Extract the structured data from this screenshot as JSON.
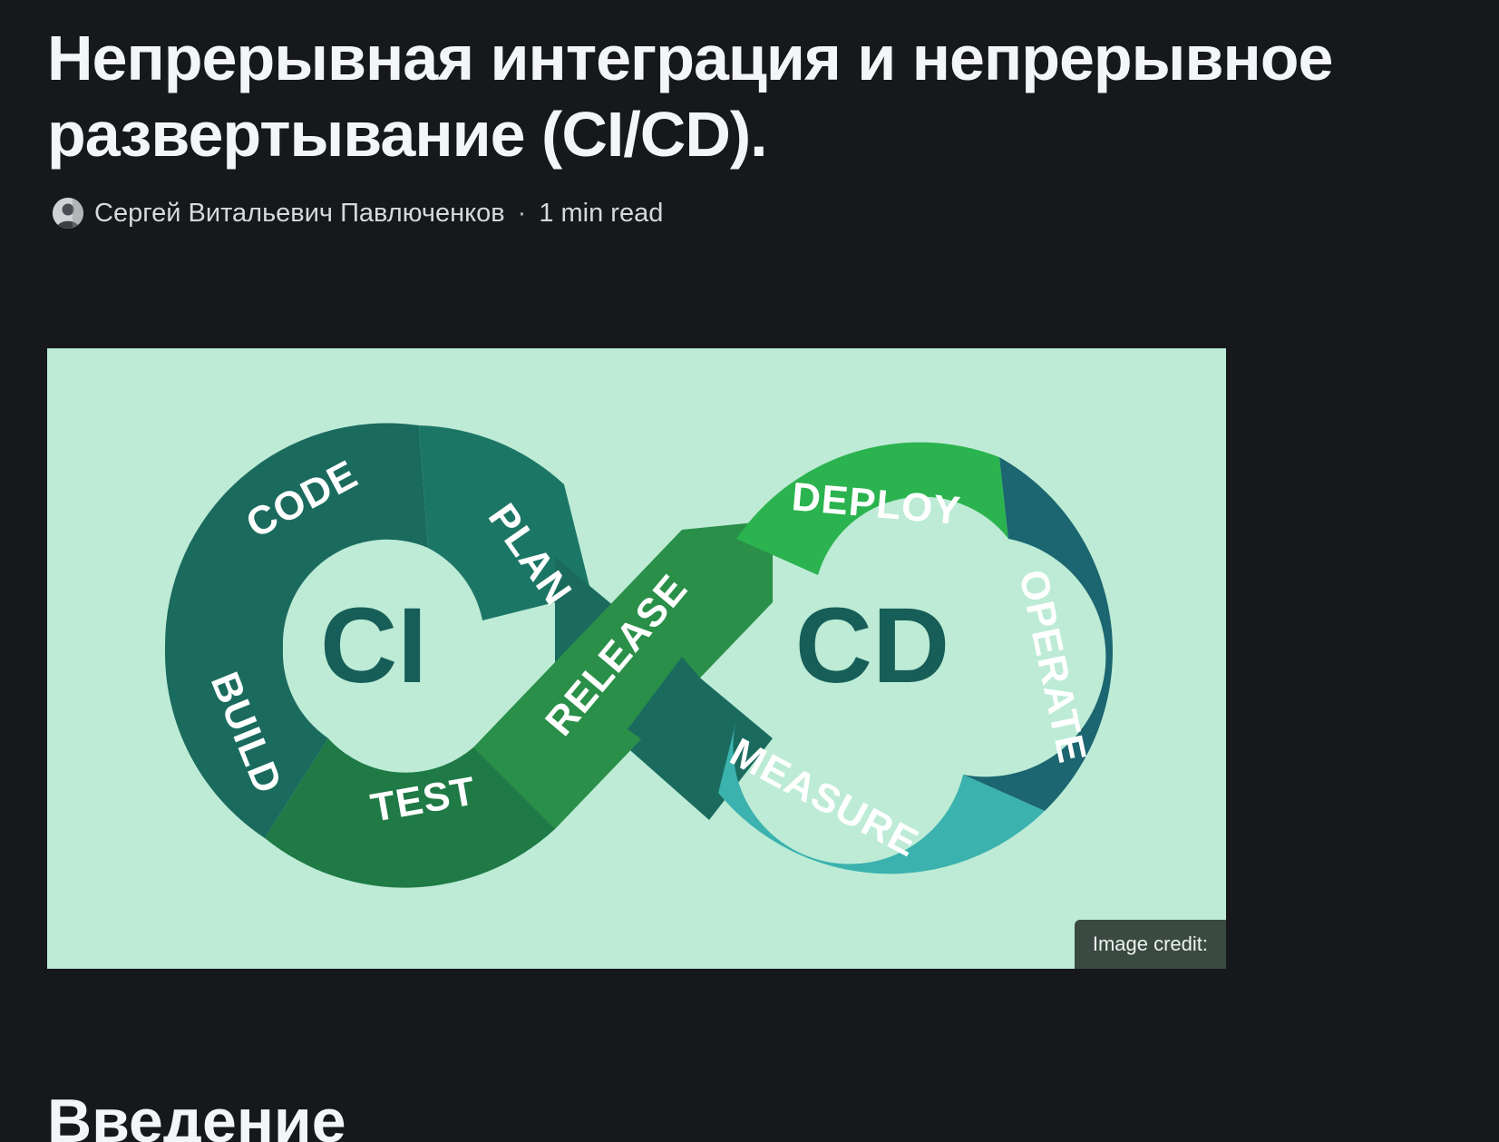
{
  "article": {
    "title": "Непрерывная интеграция и непрерывное развертывание (CI/CD).",
    "author": "Сергей Витальевич Павлюченков",
    "separator": "·",
    "read_time": "1 min read",
    "section_heading": "Введение"
  },
  "hero_image": {
    "credit": "Image credit:",
    "center_left": "CI",
    "center_right": "CD",
    "stages": {
      "code": "CODE",
      "plan": "PLAN",
      "build": "BUILD",
      "test": "TEST",
      "release": "RELEASE",
      "deploy": "DEPLOY",
      "operate": "OPERATE",
      "measure": "MEASURE"
    },
    "colors": {
      "background": "#bdebd6",
      "dark_teal": "#1a6b5e",
      "mid_green": "#1f7a45",
      "bright_green": "#2bb34f",
      "teal_blue": "#1b6670",
      "light_teal": "#3bb2ae",
      "center_text": "#175e58"
    }
  },
  "icons": {
    "avatar": "author-avatar-icon"
  }
}
